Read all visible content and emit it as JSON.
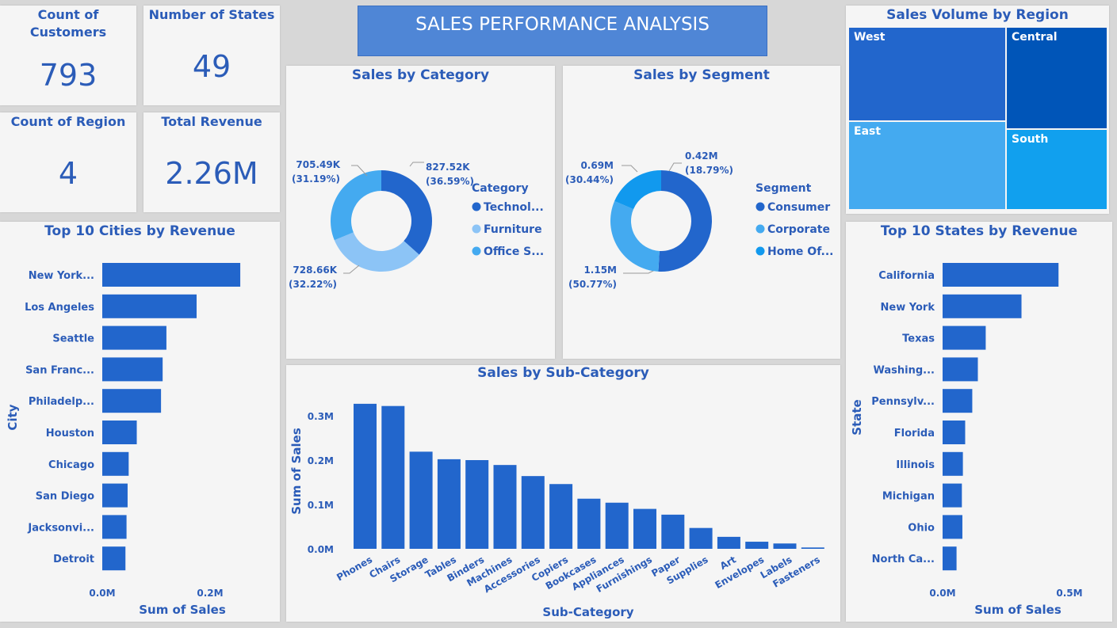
{
  "banner_title": "SALES PERFORMANCE ANALYSIS",
  "kpis": {
    "customers": {
      "label": "Count of Customers",
      "value": "793"
    },
    "states": {
      "label": "Number of States",
      "value": "49"
    },
    "regions": {
      "label": "Count of Region",
      "value": "4"
    },
    "revenue": {
      "label": "Total Revenue",
      "value": "2.26M"
    }
  },
  "colors": {
    "primary": "#2266cc",
    "title": "#2b5cb8",
    "light_blue": "#8cc4f6",
    "sky_blue": "#44aaf0",
    "bright_blue": "#1199ee"
  },
  "chart_data": [
    {
      "id": "category",
      "type": "pie",
      "title": "Sales by Category",
      "legend_title": "Category",
      "legend_placement": "right",
      "slices": [
        {
          "name": "Technol...",
          "value": 827.52,
          "label": "827.52K",
          "pct": "(36.59%)",
          "color": "#2266cc"
        },
        {
          "name": "Furniture",
          "value": 728.66,
          "label": "728.66K",
          "pct": "(32.22%)",
          "color": "#8cc4f6"
        },
        {
          "name": "Office S...",
          "value": 705.49,
          "label": "705.49K",
          "pct": "(31.19%)",
          "color": "#44aaf0"
        }
      ]
    },
    {
      "id": "segment",
      "type": "pie",
      "title": "Sales by Segment",
      "legend_title": "Segment",
      "legend_placement": "right",
      "slices": [
        {
          "name": "Consumer",
          "value": 1.15,
          "label": "1.15M",
          "pct": "(50.77%)",
          "color": "#2266cc"
        },
        {
          "name": "Corporate",
          "value": 0.69,
          "label": "0.69M",
          "pct": "(30.44%)",
          "color": "#44aaf0"
        },
        {
          "name": "Home Of...",
          "value": 0.42,
          "label": "0.42M",
          "pct": "(18.79%)",
          "color": "#1199ee"
        }
      ]
    },
    {
      "id": "region",
      "type": "treemap",
      "title": "Sales Volume by Region",
      "items": [
        {
          "name": "West",
          "value": 725.46,
          "color": "#2266cc"
        },
        {
          "name": "East",
          "value": 678.78,
          "color": "#44aaf0"
        },
        {
          "name": "Central",
          "value": 501.24,
          "color": "#0055b8"
        },
        {
          "name": "South",
          "value": 391.72,
          "color": "#11a0ee"
        }
      ]
    },
    {
      "id": "cities",
      "type": "bar",
      "orientation": "horizontal",
      "title": "Top 10 Cities by Revenue",
      "xlabel": "Sum of Sales",
      "ylabel": "City",
      "xlim": [
        0,
        0.2
      ],
      "xticks": [
        {
          "value": 0,
          "label": "0.0M"
        },
        {
          "value": 0.2,
          "label": "0.2M"
        }
      ],
      "categories": [
        "New York...",
        "Los Angeles",
        "Seattle",
        "San Franc...",
        "Philadelp...",
        "Houston",
        "Chicago",
        "San Diego",
        "Jacksonvi...",
        "Detroit"
      ],
      "values": [
        0.256,
        0.175,
        0.119,
        0.112,
        0.109,
        0.064,
        0.049,
        0.047,
        0.045,
        0.043
      ]
    },
    {
      "id": "states",
      "type": "bar",
      "orientation": "horizontal",
      "title": "Top 10 States by Revenue",
      "xlabel": "Sum of Sales",
      "ylabel": "State",
      "xlim": [
        0,
        0.5
      ],
      "xticks": [
        {
          "value": 0,
          "label": "0.0M"
        },
        {
          "value": 0.5,
          "label": "0.5M"
        }
      ],
      "categories": [
        "California",
        "New York",
        "Texas",
        "Washing...",
        "Pennsylv...",
        "Florida",
        "Illinois",
        "Michigan",
        "Ohio",
        "North Ca..."
      ],
      "values": [
        0.457,
        0.311,
        0.17,
        0.139,
        0.117,
        0.089,
        0.08,
        0.076,
        0.078,
        0.055
      ]
    },
    {
      "id": "subcategory",
      "type": "bar",
      "orientation": "vertical",
      "title": "Sales by Sub-Category",
      "xlabel": "Sub-Category",
      "ylabel": "Sum of Sales",
      "ylim": [
        0,
        0.3
      ],
      "yticks": [
        {
          "value": 0,
          "label": "0.0M"
        },
        {
          "value": 0.1,
          "label": "0.1M"
        },
        {
          "value": 0.2,
          "label": "0.2M"
        },
        {
          "value": 0.3,
          "label": "0.3M"
        }
      ],
      "categories": [
        "Phones",
        "Chairs",
        "Storage",
        "Tables",
        "Binders",
        "Machines",
        "Accessories",
        "Copiers",
        "Bookcases",
        "Appliances",
        "Furnishings",
        "Paper",
        "Supplies",
        "Art",
        "Envelopes",
        "Labels",
        "Fasteners"
      ],
      "values": [
        0.327,
        0.322,
        0.219,
        0.202,
        0.2,
        0.189,
        0.164,
        0.146,
        0.113,
        0.104,
        0.09,
        0.077,
        0.047,
        0.027,
        0.016,
        0.012,
        0.003
      ]
    }
  ]
}
